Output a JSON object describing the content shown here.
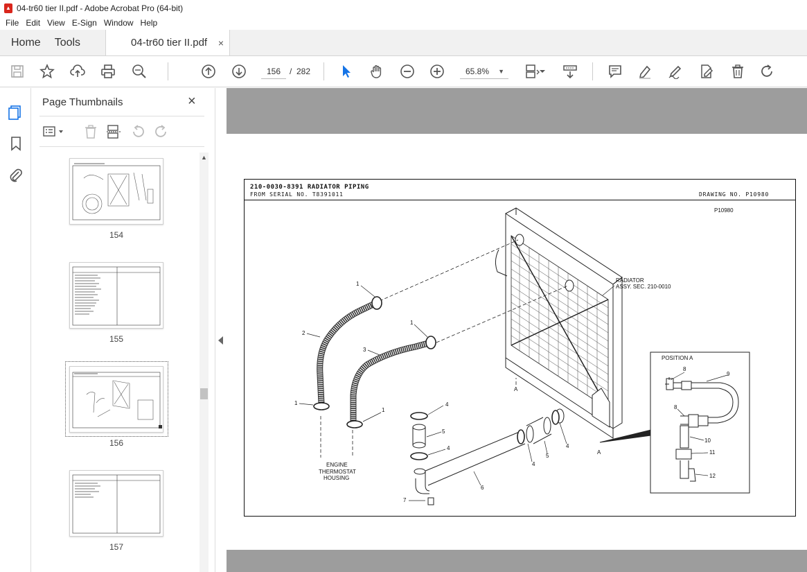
{
  "window": {
    "title": "04-tr60 tier II.pdf - Adobe Acrobat Pro (64-bit)",
    "app_icon": "acrobat-pdf-icon"
  },
  "menu": [
    "File",
    "Edit",
    "View",
    "E-Sign",
    "Window",
    "Help"
  ],
  "tabs": {
    "home": "Home",
    "tools": "Tools",
    "doc": "04-tr60 tier II.pdf",
    "close": "×"
  },
  "toolbar": {
    "page_current": "156",
    "page_sep": "/",
    "page_total": "282",
    "zoom": "65.8%"
  },
  "panel": {
    "title": "Page Thumbnails",
    "close": "×",
    "thumbnails": [
      {
        "label": "154"
      },
      {
        "label": "155"
      },
      {
        "label": "156",
        "selected": true
      },
      {
        "label": "157"
      }
    ]
  },
  "drawing": {
    "title": "210-0030-8391 RADIATOR PIPING",
    "subtitle": "FROM SERIAL NO. T8391011",
    "drawing_no": "DRAWING NO. P10980",
    "ref_code": "P10980",
    "radiator_label_1": "RADIATOR",
    "radiator_label_2": "ASSY. SEC. 210-0010",
    "position_label": "POSITION A",
    "engine_label_1": "ENGINE",
    "engine_label_2": "THERMOSTAT",
    "engine_label_3": "HOUSING",
    "callouts": {
      "c1a": "1",
      "c1b": "1",
      "c1c": "1",
      "c1d": "1",
      "c2": "2",
      "c3": "3",
      "c4a": "4",
      "c4b": "4",
      "c4c": "4",
      "c4d": "4",
      "c5a": "5",
      "c5b": "5",
      "c6": "6",
      "c7": "7",
      "c8a": "8",
      "c8b": "8",
      "c9": "9",
      "c10": "10",
      "c11": "11",
      "c12": "12",
      "a1": "A",
      "a2": "A"
    }
  }
}
